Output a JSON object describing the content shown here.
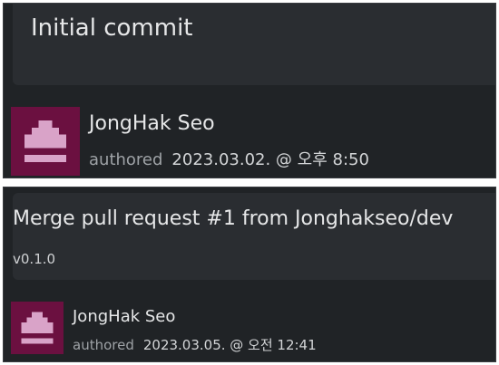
{
  "commits": [
    {
      "title": "Initial commit",
      "version": "",
      "author": "JongHak Seo",
      "authored_label": "authored",
      "timestamp": "2023.03.02. @ 오후 8:50"
    },
    {
      "title": "Merge pull request #1 from Jonghakseo/dev",
      "version": "v0.1.0",
      "author": "JongHak Seo",
      "authored_label": "authored",
      "timestamp": "2023.03.05. @ 오전 12:41"
    }
  ],
  "colors": {
    "panel_bg": "#202326",
    "avatar_bg": "#6b1040",
    "avatar_fg": "#d9a3c8"
  },
  "icons": [
    "user-avatar-icon",
    "user-avatar-icon"
  ]
}
